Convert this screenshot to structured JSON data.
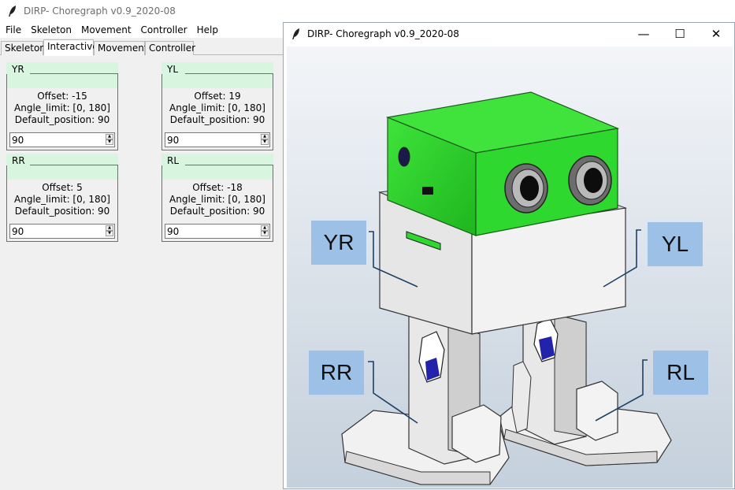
{
  "app": {
    "title": "DIRP- Choregraph v0.9_2020-08"
  },
  "menu": [
    "File",
    "Skeleton",
    "Movement",
    "Controller",
    "Help"
  ],
  "tabs": [
    {
      "label": "Skeleton",
      "active": false
    },
    {
      "label": "Interactive",
      "active": true
    },
    {
      "label": "Movement",
      "active": false
    },
    {
      "label": "Controller",
      "active": false
    }
  ],
  "joints": [
    {
      "name": "YR",
      "offset": "Offset: -15",
      "angle_limit": "Angle_limit: [0, 180]",
      "default_position": "Default_position: 90",
      "value": "90"
    },
    {
      "name": "YL",
      "offset": "Offset: 19",
      "angle_limit": "Angle_limit: [0, 180]",
      "default_position": "Default_position: 90",
      "value": "90"
    },
    {
      "name": "RR",
      "offset": "Offset: 5",
      "angle_limit": "Angle_limit: [0, 180]",
      "default_position": "Default_position: 90",
      "value": "90"
    },
    {
      "name": "RL",
      "offset": "Offset: -18",
      "angle_limit": "Angle_limit: [0, 180]",
      "default_position": "Default_position: 90",
      "value": "90"
    }
  ],
  "window": {
    "title": "DIRP- Choregraph v0.9_2020-08",
    "controls": {
      "minimize": "—",
      "maximize": "☐",
      "close": "✕"
    }
  },
  "robot_labels": {
    "yr": "YR",
    "yl": "YL",
    "rr": "RR",
    "rl": "RL"
  },
  "colors": {
    "head_green": "#2ed82e",
    "joint_header": "#d7f5df",
    "label_blue": "#9dc0e6",
    "body_gray": "#e6e6e6"
  },
  "icons": {
    "app": "feather-icon",
    "spin_up": "up-arrow-icon",
    "spin_down": "down-arrow-icon"
  }
}
